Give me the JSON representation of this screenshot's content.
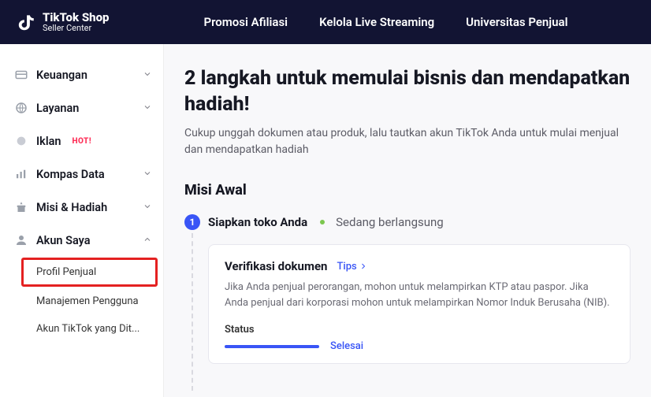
{
  "brand": {
    "line1": "TikTok Shop",
    "line2": "Seller Center"
  },
  "topnav": {
    "promo": "Promosi Afiliasi",
    "live": "Kelola Live Streaming",
    "univ": "Universitas Penjual"
  },
  "sidebar": {
    "keuangan": "Keuangan",
    "layanan": "Layanan",
    "iklan": "Iklan",
    "hot": "HOT!",
    "kompas": "Kompas Data",
    "misi": "Misi & Hadiah",
    "akun": "Akun Saya",
    "sub": {
      "profil": "Profil Penjual",
      "manajemen": "Manajemen Pengguna",
      "tiktok": "Akun TikTok yang Dit..."
    }
  },
  "main": {
    "title": "2 langkah untuk memulai bisnis dan mendapatkan hadiah!",
    "subtitle": "Cukup unggah dokumen atau produk, lalu tautkan akun TikTok Anda untuk mulai menjual dan mendapatkan hadiah",
    "section": "Misi Awal",
    "step": {
      "num": "1",
      "title": "Siapkan toko Anda",
      "status": "Sedang berlangsung"
    },
    "card": {
      "title": "Verifikasi dokumen",
      "tips": "Tips",
      "desc": "Jika Anda penjual perorangan, mohon untuk melampirkan KTP atau paspor. Jika Anda penjual dari korporasi mohon untuk melampirkan Nomor Induk Berusaha (NIB).",
      "status_label": "Status",
      "done": "Selesai"
    }
  }
}
